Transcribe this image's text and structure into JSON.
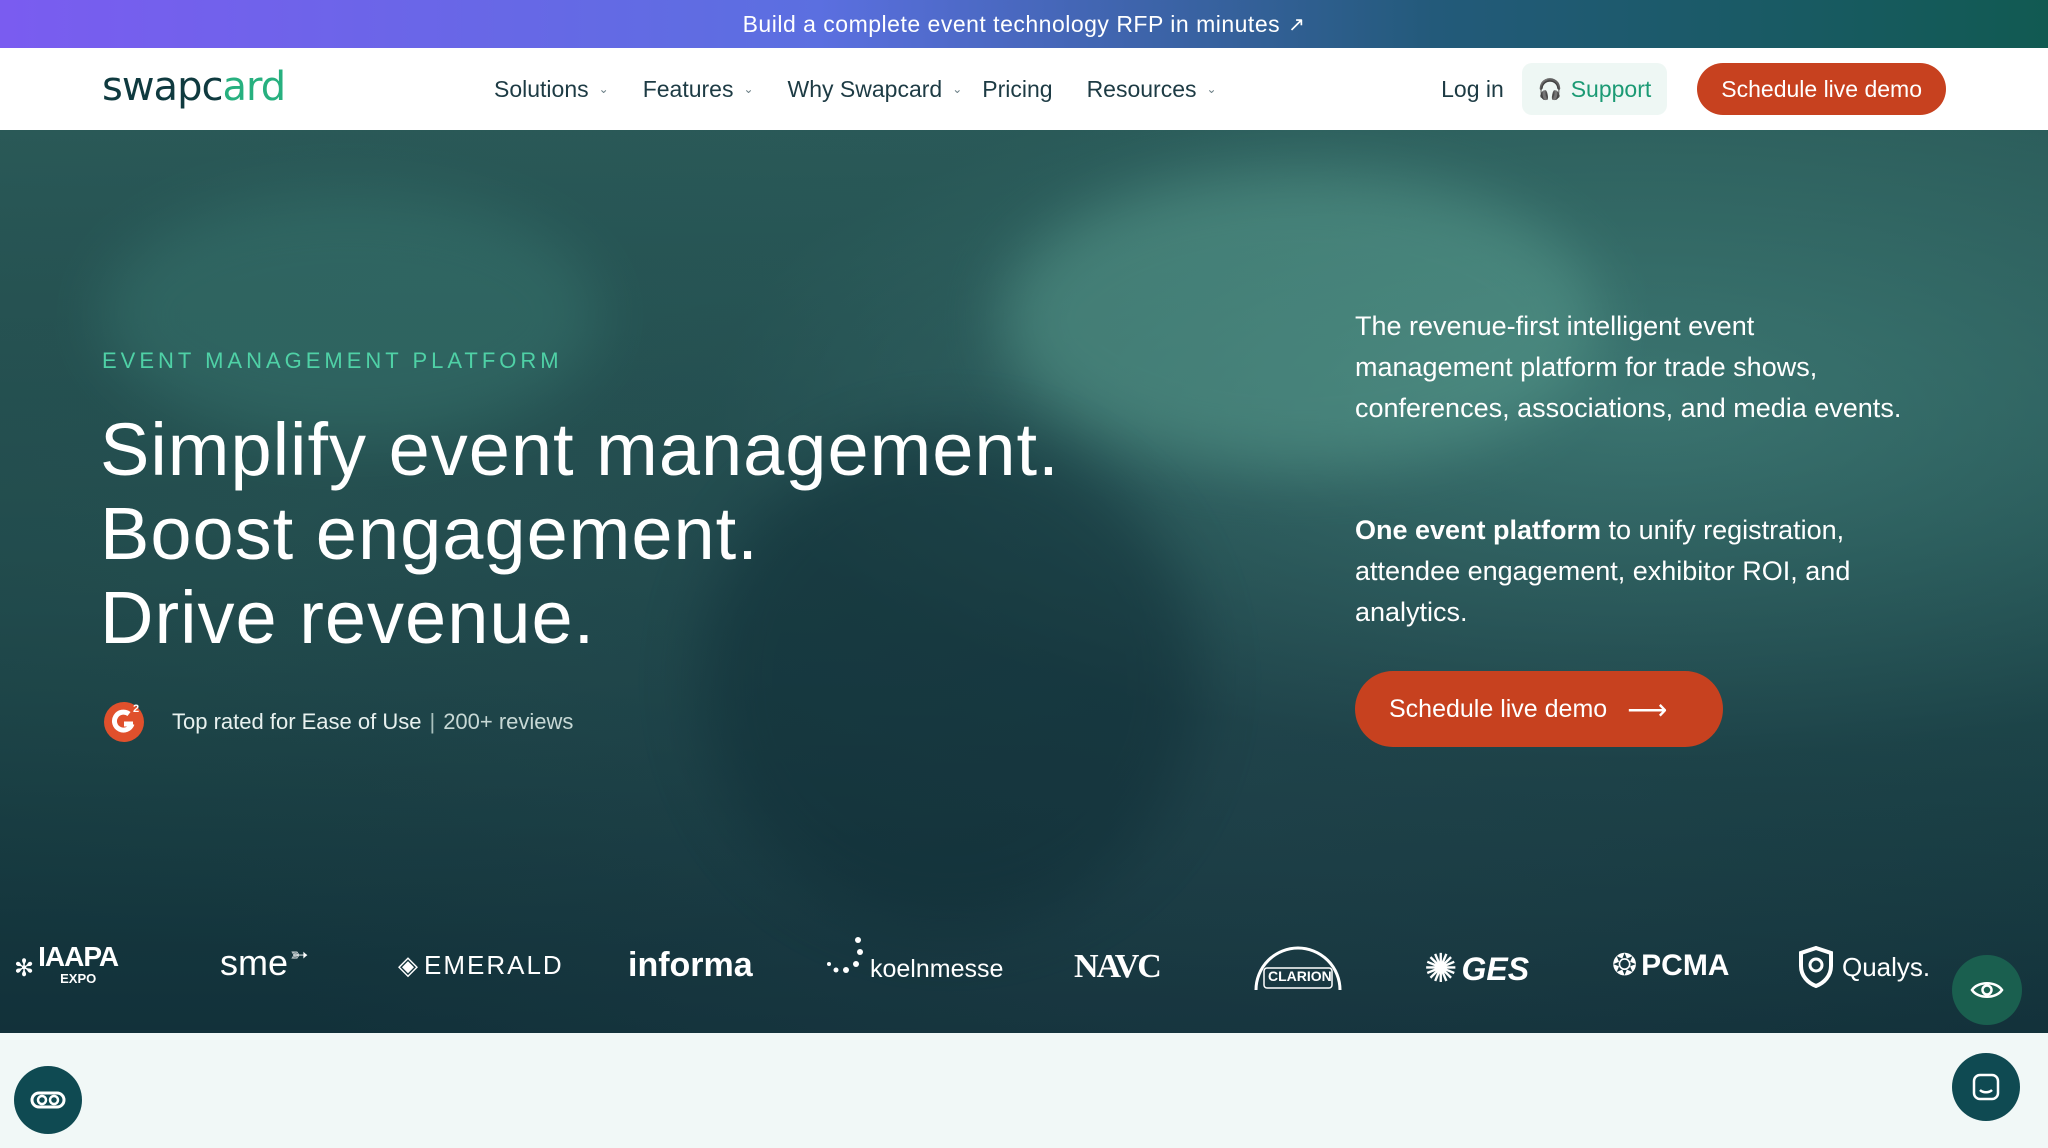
{
  "announcement": {
    "text": "Build a complete event technology RFP in minutes",
    "arrow_icon": "arrow-up-right-icon"
  },
  "nav": {
    "logo_text_main": "swapc",
    "logo_text_accent": "ard",
    "items": [
      {
        "label": "Solutions",
        "has_dropdown": true
      },
      {
        "label": "Features",
        "has_dropdown": true
      },
      {
        "label": "Why Swapcard",
        "has_dropdown": true
      },
      {
        "label": "Pricing",
        "has_dropdown": false
      },
      {
        "label": "Resources",
        "has_dropdown": true
      }
    ],
    "login": "Log in",
    "support": "Support",
    "demo": "Schedule live demo"
  },
  "hero": {
    "eyebrow": "EVENT MANAGEMENT PLATFORM",
    "headline_lines": [
      "Simplify event management.",
      "Boost engagement.",
      "Drive revenue."
    ],
    "rating_text": "Top rated for Ease of Use",
    "rating_separator": "|",
    "rating_reviews": "200+ reviews",
    "lede": "The revenue-first intelligent event management platform for trade shows, conferences, associations, and media events.",
    "lede2_bold": "One event platform",
    "lede2_rest": " to unify registration, attendee engagement, exhibitor ROI, and analytics.",
    "demo": "Schedule live demo"
  },
  "logos": {
    "iaapa": "IAAPA",
    "iaapa_sub": "EXPO",
    "sme": "sme",
    "emerald": "EMERALD",
    "informa": "informa",
    "koelnmesse": "koelnmesse",
    "navc": "NAVC",
    "clarion": "CLARION",
    "ges": "GES",
    "pcma": "PCMA",
    "qualys": "Qualys."
  },
  "colors": {
    "accent": "#c7411f",
    "brand_green": "#27b07f",
    "eyebrow": "#4fd1a6"
  }
}
